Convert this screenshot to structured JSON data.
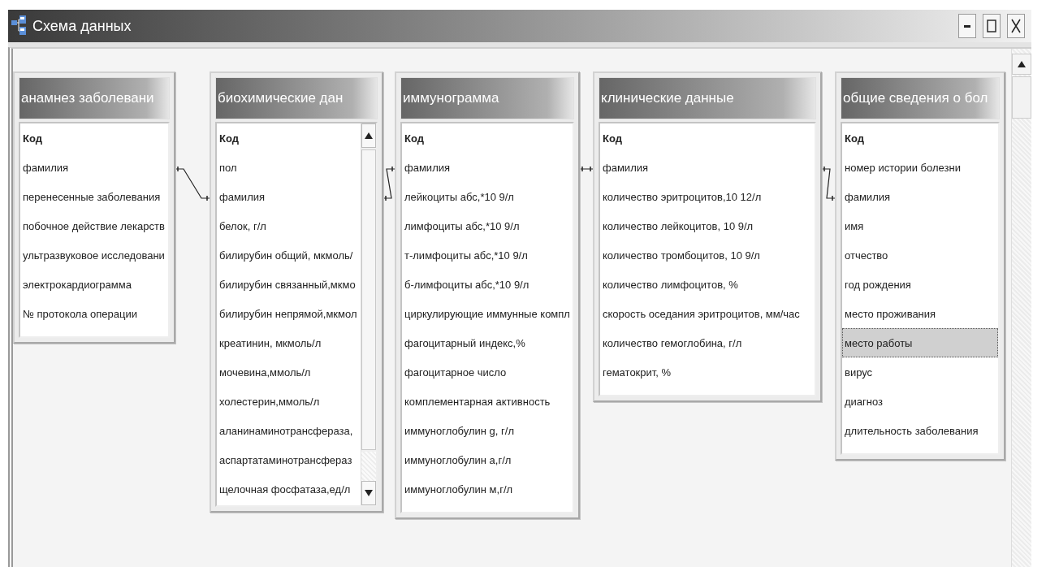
{
  "window": {
    "title": "Схема данных"
  },
  "tables": [
    {
      "title": "анамнез заболевани",
      "scrollable": false,
      "fields": [
        {
          "name": "Код",
          "primary_key": true,
          "selected": false
        },
        {
          "name": "фамилия",
          "primary_key": false,
          "selected": false
        },
        {
          "name": "перенесенные заболевания",
          "primary_key": false,
          "selected": false
        },
        {
          "name": "побочное действие лекарств",
          "primary_key": false,
          "selected": false
        },
        {
          "name": "ультразвуковое исследовани",
          "primary_key": false,
          "selected": false
        },
        {
          "name": "электрокардиограмма",
          "primary_key": false,
          "selected": false
        },
        {
          "name": "№ протокола операции",
          "primary_key": false,
          "selected": false
        }
      ]
    },
    {
      "title": "биохимические дан",
      "scrollable": true,
      "fields": [
        {
          "name": "Код",
          "primary_key": true,
          "selected": false
        },
        {
          "name": "пол",
          "primary_key": false,
          "selected": false
        },
        {
          "name": "фамилия",
          "primary_key": false,
          "selected": false
        },
        {
          "name": "белок, г/л",
          "primary_key": false,
          "selected": false
        },
        {
          "name": "билирубин общий, мкмоль/",
          "primary_key": false,
          "selected": false
        },
        {
          "name": "билирубин связанный,мкмо",
          "primary_key": false,
          "selected": false
        },
        {
          "name": "билирубин непрямой,мкмол",
          "primary_key": false,
          "selected": false
        },
        {
          "name": "креатинин, мкмоль/л",
          "primary_key": false,
          "selected": false
        },
        {
          "name": "мочевина,ммоль/л",
          "primary_key": false,
          "selected": false
        },
        {
          "name": "холестерин,ммоль/л",
          "primary_key": false,
          "selected": false
        },
        {
          "name": "аланинаминотрансфераза,",
          "primary_key": false,
          "selected": false
        },
        {
          "name": "аспартатаминотрансфераз",
          "primary_key": false,
          "selected": false
        },
        {
          "name": "щелочная фосфатаза,ед/л",
          "primary_key": false,
          "selected": false
        }
      ]
    },
    {
      "title": "иммунограмма",
      "scrollable": false,
      "fields": [
        {
          "name": "Код",
          "primary_key": true,
          "selected": false
        },
        {
          "name": "фамилия",
          "primary_key": false,
          "selected": false
        },
        {
          "name": "лейкоциты абс,*10 9/л",
          "primary_key": false,
          "selected": false
        },
        {
          "name": "лимфоциты абс,*10 9/л",
          "primary_key": false,
          "selected": false
        },
        {
          "name": "т-лимфоциты абс,*10 9/л",
          "primary_key": false,
          "selected": false
        },
        {
          "name": "б-лимфоциты абс,*10 9/л",
          "primary_key": false,
          "selected": false
        },
        {
          "name": "циркулирующие иммунные компл",
          "primary_key": false,
          "selected": false
        },
        {
          "name": "фагоцитарный индекс,%",
          "primary_key": false,
          "selected": false
        },
        {
          "name": "фагоцитарное число",
          "primary_key": false,
          "selected": false
        },
        {
          "name": "комплементарная активность",
          "primary_key": false,
          "selected": false
        },
        {
          "name": "иммуноглобулин g, г/л",
          "primary_key": false,
          "selected": false
        },
        {
          "name": "иммуноглобулин а,г/л",
          "primary_key": false,
          "selected": false
        },
        {
          "name": "иммуноглобулин м,г/л",
          "primary_key": false,
          "selected": false
        }
      ]
    },
    {
      "title": "клинические данные",
      "scrollable": false,
      "fields": [
        {
          "name": "Код",
          "primary_key": true,
          "selected": false
        },
        {
          "name": "фамилия",
          "primary_key": false,
          "selected": false
        },
        {
          "name": "количество эритроцитов,10 12/л",
          "primary_key": false,
          "selected": false
        },
        {
          "name": "количество лейкоцитов, 10 9/л",
          "primary_key": false,
          "selected": false
        },
        {
          "name": "количество тромбоцитов, 10 9/л",
          "primary_key": false,
          "selected": false
        },
        {
          "name": "количество лимфоцитов, %",
          "primary_key": false,
          "selected": false
        },
        {
          "name": "скорость оседания эритроцитов, мм/час",
          "primary_key": false,
          "selected": false
        },
        {
          "name": "количество гемоглобина, г/л",
          "primary_key": false,
          "selected": false
        },
        {
          "name": "гематокрит, %",
          "primary_key": false,
          "selected": false
        }
      ]
    },
    {
      "title": "общие сведения о бол",
      "scrollable": false,
      "fields": [
        {
          "name": "Код",
          "primary_key": true,
          "selected": false
        },
        {
          "name": "номер истории болезни",
          "primary_key": false,
          "selected": false
        },
        {
          "name": "фамилия",
          "primary_key": false,
          "selected": false
        },
        {
          "name": "имя",
          "primary_key": false,
          "selected": false
        },
        {
          "name": "отчество",
          "primary_key": false,
          "selected": false
        },
        {
          "name": "год рождения",
          "primary_key": false,
          "selected": false
        },
        {
          "name": "место проживания",
          "primary_key": false,
          "selected": false
        },
        {
          "name": "место работы",
          "primary_key": false,
          "selected": true
        },
        {
          "name": "вирус",
          "primary_key": false,
          "selected": false
        },
        {
          "name": "диагноз",
          "primary_key": false,
          "selected": false
        },
        {
          "name": "длительность заболевания",
          "primary_key": false,
          "selected": false
        }
      ]
    }
  ]
}
